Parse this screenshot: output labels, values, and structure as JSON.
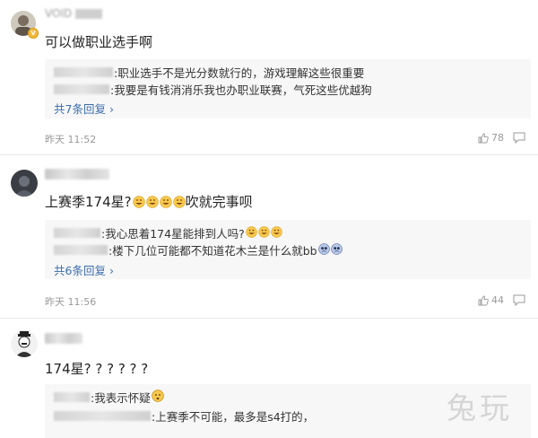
{
  "comments": [
    {
      "username": "VOID",
      "text": "可以做职业选手啊",
      "replies": [
        {
          "text": ":职业选手不是光分数就行的，游戏理解这些很重要"
        },
        {
          "text": ":我要是有钱消消乐我也办职业联赛，气死这些优越狗"
        }
      ],
      "more": "共7条回复",
      "time": "昨天 11:52",
      "likes": "78"
    },
    {
      "username": "",
      "text": "上赛季174星?",
      "text_after": "吹就完事呗",
      "replies": [
        {
          "text": ":我心思着174星能排到人吗?"
        },
        {
          "text": ":楼下几位可能都不知道花木兰是什么就bb"
        }
      ],
      "more": "共6条回复",
      "time": "昨天 11:56",
      "likes": "44"
    },
    {
      "username": "",
      "text": "174星? ? ? ? ? ?",
      "replies": [
        {
          "text": ":我表示怀疑"
        },
        {
          "text": ":上赛季不可能，最多是s4打的，"
        }
      ]
    }
  ],
  "watermark": "兔玩",
  "colors": {
    "link": "#3b6dad",
    "time": "#999999",
    "reply_bg": "#f7f7f7",
    "badge": "#f3b73b"
  },
  "icons": [
    "vip-badge-icon",
    "like-thumb-icon",
    "reply-bubble-icon",
    "grin-emoji-icon",
    "laugh-cry-emoji-icon",
    "doubt-emoji-icon",
    "cat-grin-emoji-icon"
  ]
}
